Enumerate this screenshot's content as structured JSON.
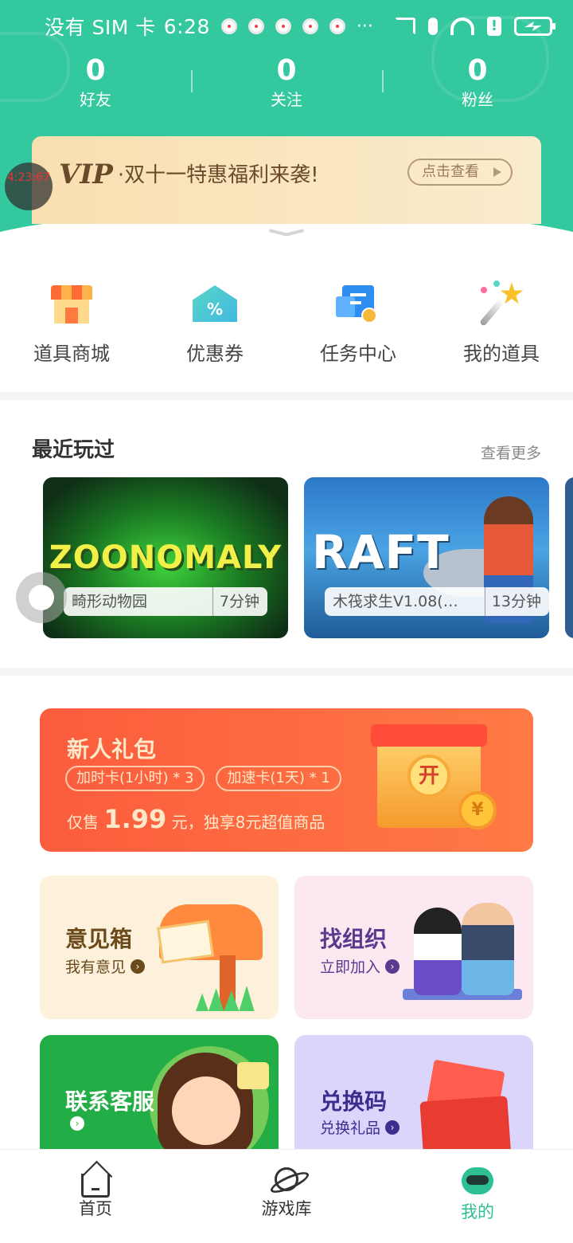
{
  "status_bar": {
    "carrier": "没有 SIM 卡",
    "time": "6:28",
    "more": "···",
    "alert": "!"
  },
  "stats": [
    {
      "value": "0",
      "label": "好友"
    },
    {
      "value": "0",
      "label": "关注"
    },
    {
      "value": "0",
      "label": "粉丝"
    }
  ],
  "vip_banner": {
    "badge": "VIP",
    "text": "·双十一特惠福利来袭!",
    "button": "点击查看"
  },
  "floating_timer": {
    "text": "4:23:67"
  },
  "quick_entries": [
    {
      "label": "道具商城",
      "icon": "shop-icon"
    },
    {
      "label": "优惠券",
      "icon": "coupon-icon"
    },
    {
      "label": "任务中心",
      "icon": "task-center-icon"
    },
    {
      "label": "我的道具",
      "icon": "magic-wand-icon"
    }
  ],
  "recent": {
    "title": "最近玩过",
    "more": "查看更多",
    "games": [
      {
        "logo": "ZOONOMALY",
        "name": "畸形动物园",
        "duration": "7分钟"
      },
      {
        "logo": "RAFT",
        "name": "木筏求生V1.08(…",
        "duration": "13分钟"
      }
    ]
  },
  "newbie_pack": {
    "title": "新人礼包",
    "tags": [
      "加时卡(1小时) * 3",
      "加速卡(1天) * 1"
    ],
    "price_prefix": "仅售",
    "price": "1.99",
    "price_suffix": "元，独享8元超值商品",
    "open_label": "开",
    "coin_label": "¥"
  },
  "cards": {
    "feedback": {
      "title": "意见箱",
      "sub": "我有意见"
    },
    "group": {
      "title": "找组织",
      "sub": "立即加入"
    },
    "service": {
      "title": "联系客服",
      "sub": ""
    },
    "code": {
      "title": "兑换码",
      "sub": "兑换礼品"
    }
  },
  "bottom_nav": [
    {
      "label": "首页",
      "active": false
    },
    {
      "label": "游戏库",
      "active": false
    },
    {
      "label": "我的",
      "active": true
    }
  ],
  "colors": {
    "brand_green": "#34c89f",
    "active_tab": "#2fbf95",
    "pack_orange": "#fb5c3d"
  }
}
